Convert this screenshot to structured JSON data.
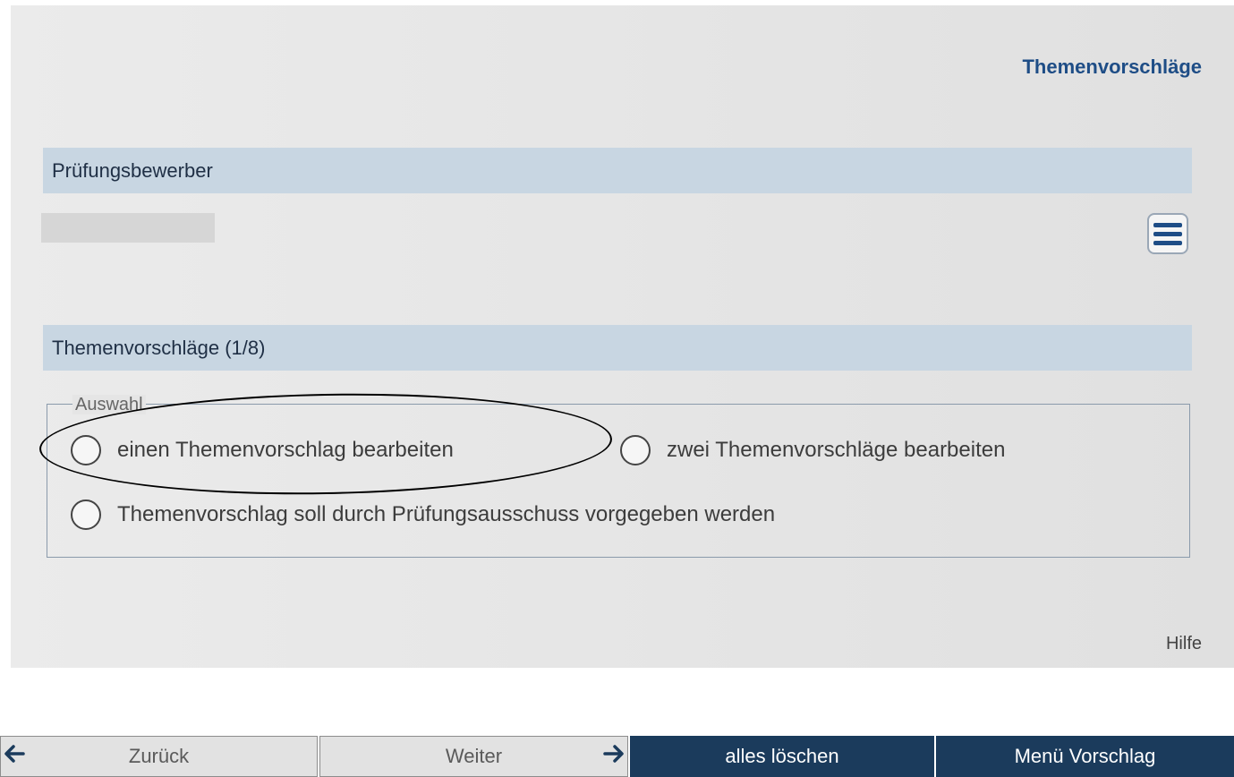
{
  "header": {
    "title": "Themenvorschläge"
  },
  "candidate_section": {
    "title": "Prüfungsbewerber"
  },
  "topics_section": {
    "title": "Themenvorschläge (1/8)"
  },
  "selection": {
    "legend": "Auswahl",
    "options": [
      {
        "label": "einen Themenvorschlag bearbeiten",
        "selected": false
      },
      {
        "label": "zwei Themenvorschläge bearbeiten",
        "selected": false
      },
      {
        "label": "Themenvorschlag soll durch Prüfungsausschuss vorgegeben werden",
        "selected": false
      }
    ]
  },
  "help_label": "Hilfe",
  "footer": {
    "back_label": "Zurück",
    "next_label": "Weiter",
    "clear_label": "alles löschen",
    "menu_label": "Menü Vorschlag"
  },
  "icons": {
    "menu": "hamburger-menu-icon",
    "back": "arrow-left-icon",
    "next": "arrow-right-icon"
  },
  "colors": {
    "accent": "#1e4d86",
    "section_bar": "#c8d6e2",
    "dark_button": "#1b3b5c"
  }
}
